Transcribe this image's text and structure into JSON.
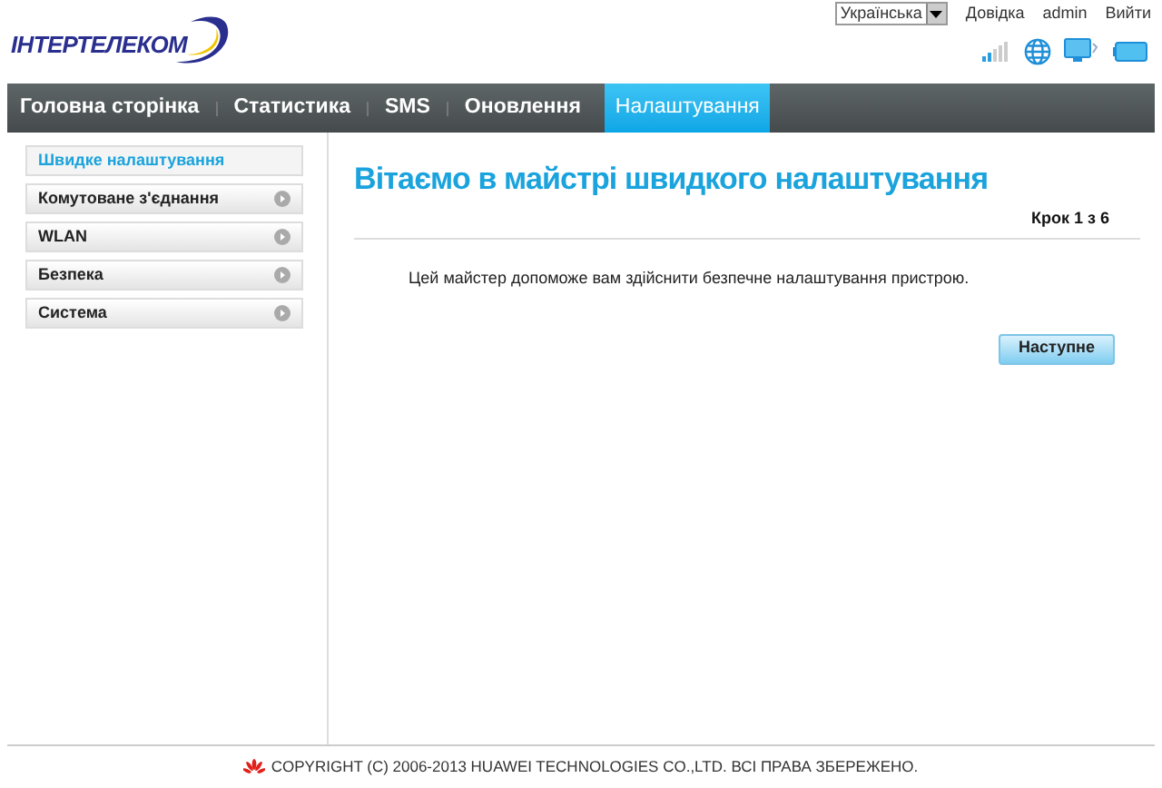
{
  "logo": {
    "text": "ІНТЕРТЕЛЕКОМ"
  },
  "top_bar": {
    "language": "Українська",
    "links": [
      "Довідка",
      "admin",
      "Вийти"
    ]
  },
  "nav": [
    {
      "label": "Головна сторінка",
      "selected": false
    },
    {
      "label": "Статистика",
      "selected": false
    },
    {
      "label": "SMS",
      "selected": false
    },
    {
      "label": "Оновлення",
      "selected": false
    },
    {
      "label": "Налаштування",
      "selected": true
    }
  ],
  "sidebar": [
    {
      "label": "Швидке налаштування",
      "selected": true,
      "expandable": false
    },
    {
      "label": "Комутоване з'єднання",
      "selected": false,
      "expandable": true
    },
    {
      "label": "WLAN",
      "selected": false,
      "expandable": true
    },
    {
      "label": "Безпека",
      "selected": false,
      "expandable": true
    },
    {
      "label": "Система",
      "selected": false,
      "expandable": true
    }
  ],
  "content": {
    "title": "Вітаємо в майстрі швидкого налаштування",
    "step": "Крок 1 з 6",
    "message": "Цей майстер допоможе вам здійснити безпечне налаштування пристрою.",
    "next_button": "Наступне"
  },
  "footer": {
    "copyright": "COPYRIGHT (C) 2006-2013 HUAWEI TECHNOLOGIES CO.,LTD. ВСІ ПРАВА ЗБЕРЕЖЕНО."
  }
}
